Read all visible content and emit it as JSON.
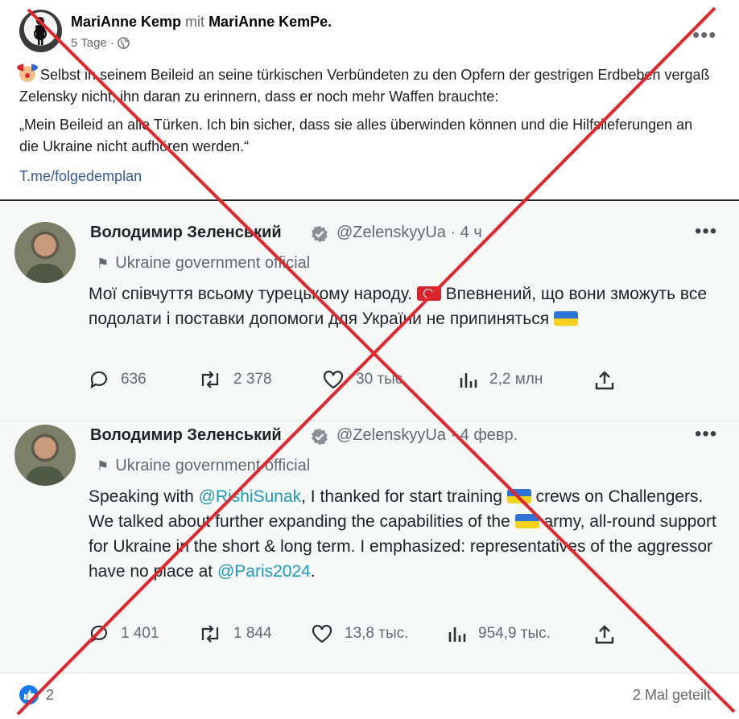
{
  "post": {
    "author": "MariAnne Kemp",
    "with_word": "mit",
    "coauthor": "MariAnne KemPe.",
    "time": "5 Tage",
    "sep": "·",
    "more_label": "•••",
    "text1": "Selbst in seinem Beileid an seine türkischen Verbündeten zu den Opfern der gestrigen Erdbeben vergaß Zelensky nicht, ihn daran zu erinnern, dass er noch mehr Waffen brauchte:",
    "text2": "„Mein Beileid an alle Türken. Ich bin sicher, dass sie alles überwinden können und die Hilfslieferungen an die Ukraine nicht aufhören werden.“",
    "link": "T.me/folgedemplan"
  },
  "tweets": [
    {
      "name": "Володимир Зеленський",
      "handle": "@ZelenskyyUa · 4 ч",
      "label": "Ukraine government official",
      "body_a": "Мої співчуття всьому турецькому народу.",
      "body_b": "Впевнений, що вони зможуть все подолати і поставки допомоги для України не припиняться",
      "replies": "636",
      "retweets": "2 378",
      "likes": "30 тыс.",
      "views": "2,2 млн"
    },
    {
      "name": "Володимир Зеленський",
      "handle": "@ZelenskyyUa · 4 февр.",
      "label": "Ukraine government official",
      "body_a": "Speaking with",
      "mention1": "@RishiSunak",
      "body_b": ", I thanked for start training",
      "body_c": "crews on Challengers. We talked about further expanding the capabilities of the",
      "body_d": "army, all-round support for Ukraine in the short & long term. I emphasized: representatives of the aggressor have no place at",
      "mention2": "@Paris2024",
      "body_e": ".",
      "replies": "1 401",
      "retweets": "1 844",
      "likes": "13,8 тыс.",
      "views": "954,9 тыс."
    }
  ],
  "footer": {
    "reaction_count": "2",
    "shares": "2 Mal geteilt"
  },
  "colors": {
    "cross": "#e3262c",
    "link": "#385898",
    "mention": "#1d9bb8"
  }
}
